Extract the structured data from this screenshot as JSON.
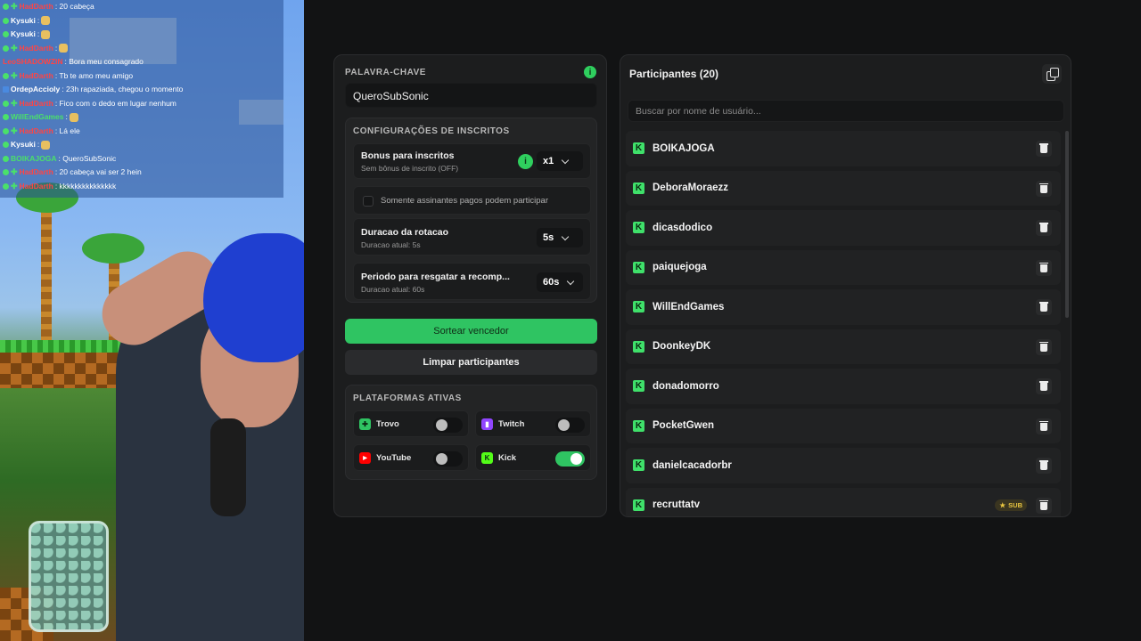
{
  "chat": {
    "lines": [
      {
        "user": "HadDarth",
        "text": ": 20 cabeça",
        "user_color": "#ff4444",
        "badges": [
          "dot",
          "plus"
        ],
        "emote": false
      },
      {
        "user": "Kysuki",
        "text": ":",
        "user_color": "#ffffff",
        "badges": [
          "dot"
        ],
        "emote": true
      },
      {
        "user": "Kysuki",
        "text": ":",
        "user_color": "#ffffff",
        "badges": [
          "dot"
        ],
        "emote": true
      },
      {
        "user": "HadDarth",
        "text": ":",
        "user_color": "#ff4444",
        "badges": [
          "dot",
          "plus"
        ],
        "emote": true
      },
      {
        "user": "LeoSHADOWZIN",
        "text": ": Bora meu consagrado",
        "user_color": "#ff4444",
        "badges": [],
        "emote": false
      },
      {
        "user": "HadDarth",
        "text": ": Tb te amo meu amigo",
        "user_color": "#ff4444",
        "badges": [
          "dot",
          "plus"
        ],
        "emote": false
      },
      {
        "user": "OrdepAccioly",
        "text": ": 23h rapaziada, chegou o momento",
        "user_color": "#ffffff",
        "badges": [
          "square"
        ],
        "emote": false
      },
      {
        "user": "HadDarth",
        "text": ": Fico com o dedo em lugar nenhum",
        "user_color": "#ff4444",
        "badges": [
          "dot",
          "plus"
        ],
        "emote": false
      },
      {
        "user": "WillEndGames",
        "text": ":",
        "user_color": "#4ae06a",
        "badges": [
          "dot"
        ],
        "emote": true
      },
      {
        "user": "HadDarth",
        "text": ": Lá ele",
        "user_color": "#ff4444",
        "badges": [
          "dot",
          "plus"
        ],
        "emote": false
      },
      {
        "user": "Kysuki",
        "text": ":",
        "user_color": "#ffffff",
        "badges": [
          "dot"
        ],
        "emote": true
      },
      {
        "user": "BOIKAJOGA",
        "text": ": QueroSubSonic",
        "user_color": "#4ae06a",
        "badges": [
          "dot"
        ],
        "emote": false
      },
      {
        "user": "HadDarth",
        "text": ": 20 cabeça vai ser 2 hein",
        "user_color": "#ff4444",
        "badges": [
          "dot",
          "plus"
        ],
        "emote": false
      },
      {
        "user": "HadDarth",
        "text": ": kkkkkkkkkkkkkkk",
        "user_color": "#ff4444",
        "badges": [
          "dot",
          "plus"
        ],
        "emote": false
      }
    ]
  },
  "settings": {
    "keyword_label": "PALAVRA-CHAVE",
    "keyword_info": "i",
    "keyword_value": "QueroSubSonic",
    "sub_config_label": "CONFIGURAÇÕES DE INSCRITOS",
    "bonus_title": "Bonus para inscritos",
    "bonus_sub": "Sem bônus de inscrito (OFF)",
    "bonus_info": "i",
    "bonus_value": "x1",
    "paid_only_label": "Somente assinantes pagos podem participar",
    "rotation_title": "Duracao da rotacao",
    "rotation_sub": "Duracao atual: 5s",
    "rotation_value": "5s",
    "claim_title": "Periodo para resgatar a recomp...",
    "claim_sub": "Duracao atual: 60s",
    "claim_value": "60s",
    "draw_button": "Sortear vencedor",
    "clear_button": "Limpar participantes",
    "platforms_label": "PLATAFORMAS ATIVAS",
    "platforms": [
      {
        "name": "Trovo",
        "active": false,
        "color": "#2fc462"
      },
      {
        "name": "Twitch",
        "active": false,
        "color": "#9146ff"
      },
      {
        "name": "YouTube",
        "active": false,
        "color": "#ff0000"
      },
      {
        "name": "Kick",
        "active": true,
        "color": "#53fc18"
      }
    ]
  },
  "participants": {
    "title": "Participantes (20)",
    "search_placeholder": "Buscar por nome de usuário...",
    "sub_badge": "SUB",
    "list": [
      {
        "name": "BOIKAJOGA",
        "sub": false
      },
      {
        "name": "DeboraMoraezz",
        "sub": false
      },
      {
        "name": "dicasdodico",
        "sub": false
      },
      {
        "name": "paiquejoga",
        "sub": false
      },
      {
        "name": "WillEndGames",
        "sub": false
      },
      {
        "name": "DoonkeyDK",
        "sub": false
      },
      {
        "name": "donadomorro",
        "sub": false
      },
      {
        "name": "PocketGwen",
        "sub": false
      },
      {
        "name": "danielcacadorbr",
        "sub": false
      },
      {
        "name": "recruttatv",
        "sub": true
      }
    ]
  },
  "colors": {
    "accent_green": "#2fc462",
    "kick_green": "#3fe06a",
    "panel_bg": "#1c1d1e",
    "page_bg": "#121314"
  },
  "icons": {
    "copy": "copy-icon",
    "trash": "trash-icon",
    "kick": "kick-icon",
    "star": "star-icon",
    "chevron": "chevron-down-icon",
    "info": "info-icon"
  }
}
